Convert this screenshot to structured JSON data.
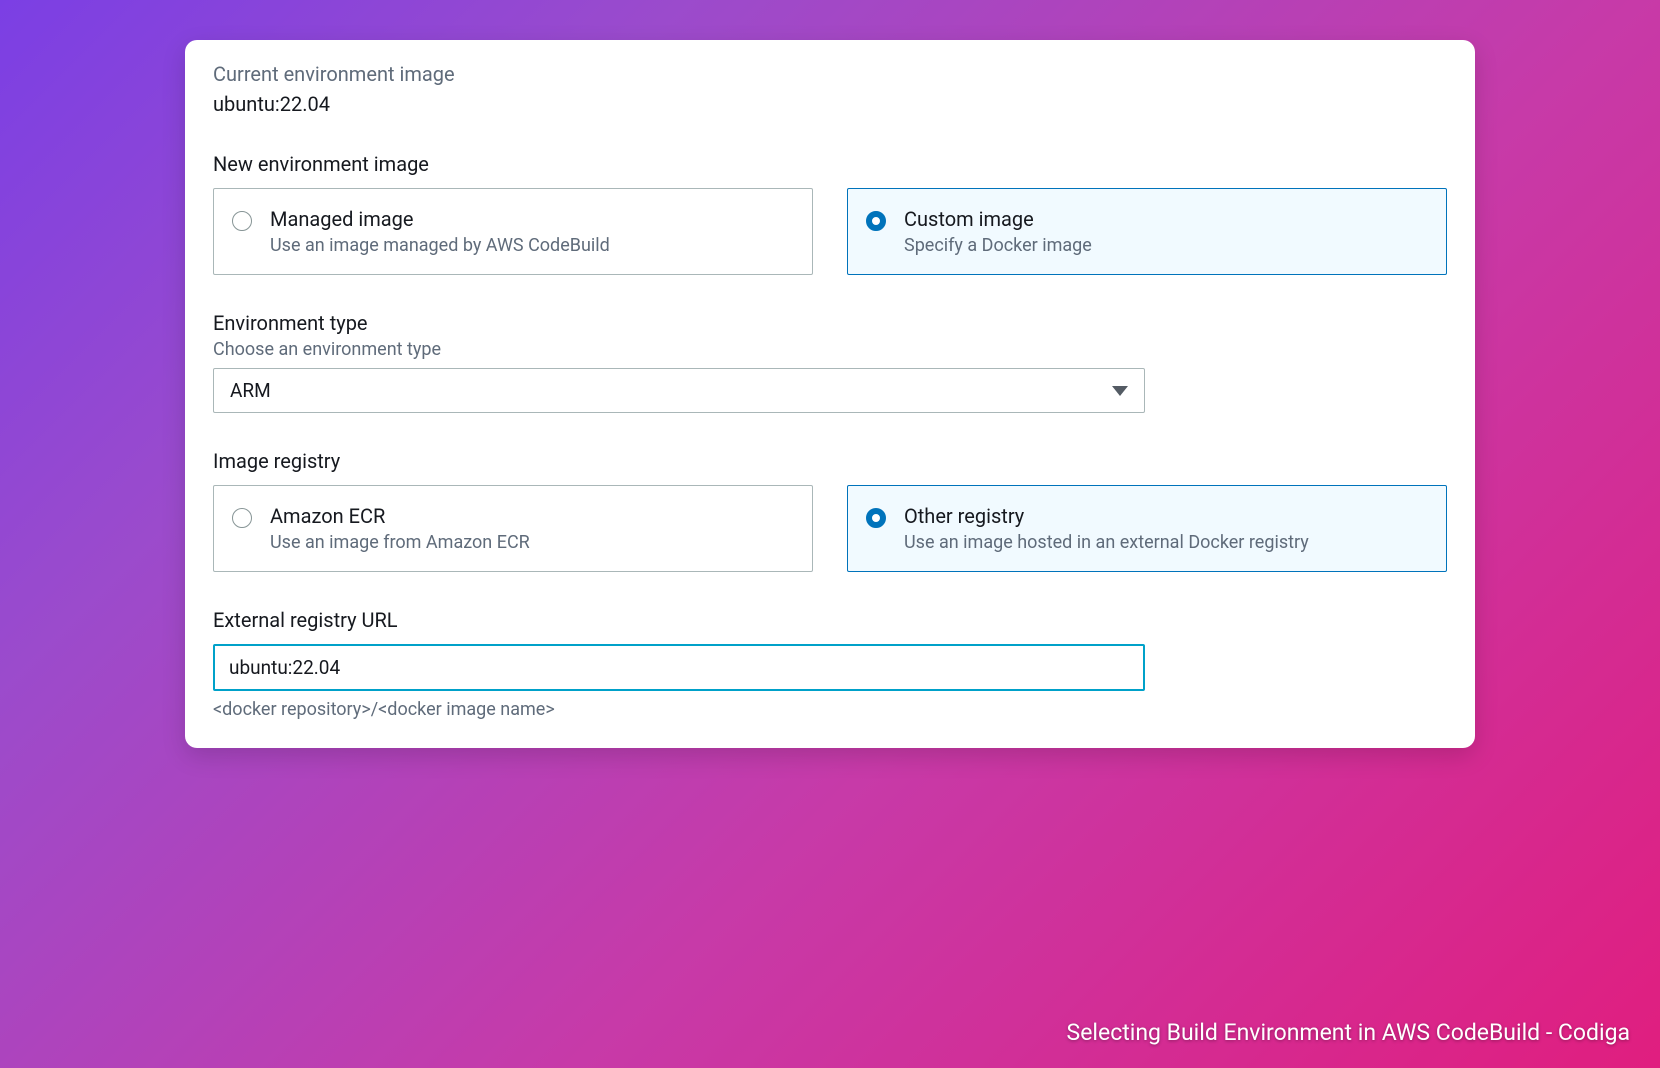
{
  "current": {
    "label": "Current environment image",
    "value": "ubuntu:22.04"
  },
  "newImage": {
    "label": "New environment image",
    "options": [
      {
        "title": "Managed image",
        "desc": "Use an image managed by AWS CodeBuild"
      },
      {
        "title": "Custom image",
        "desc": "Specify a Docker image"
      }
    ]
  },
  "envType": {
    "label": "Environment type",
    "help": "Choose an environment type",
    "selected": "ARM"
  },
  "registry": {
    "label": "Image registry",
    "options": [
      {
        "title": "Amazon ECR",
        "desc": "Use an image from Amazon ECR"
      },
      {
        "title": "Other registry",
        "desc": "Use an image hosted in an external Docker registry"
      }
    ]
  },
  "externalUrl": {
    "label": "External registry URL",
    "value": "ubuntu:22.04",
    "help": "<docker repository>/<docker image name>"
  },
  "caption": "Selecting Build Environment in AWS CodeBuild - Codiga"
}
